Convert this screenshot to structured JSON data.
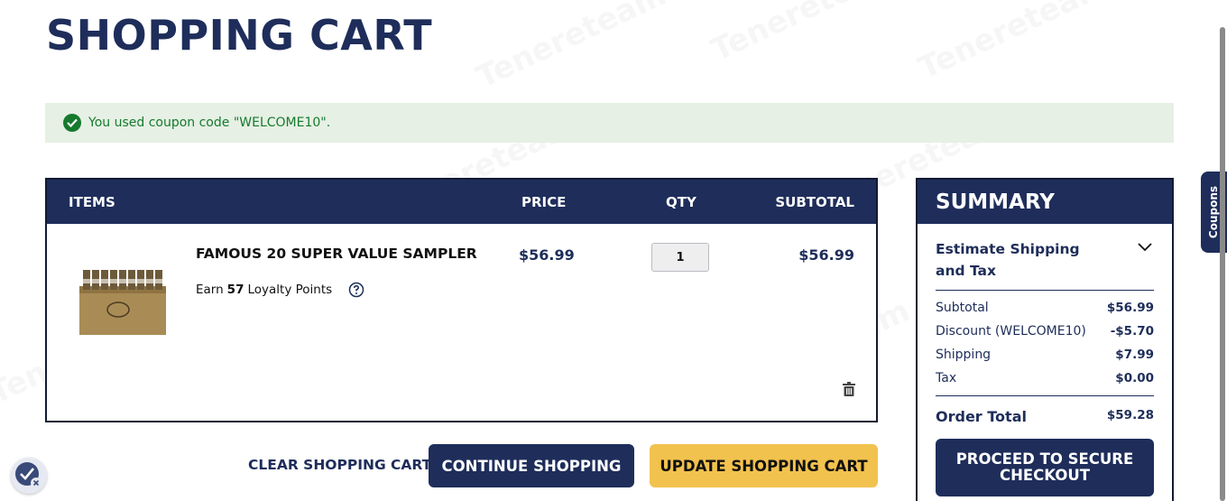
{
  "page": {
    "title": "SHOPPING CART"
  },
  "alert": {
    "message": "You used coupon code \"WELCOME10\"."
  },
  "cart": {
    "headers": {
      "items": "ITEMS",
      "price": "PRICE",
      "qty": "QTY",
      "subtotal": "SUBTOTAL"
    },
    "item": {
      "name": "FAMOUS 20 SUPER VALUE SAMPLER",
      "loyalty_prefix": "Earn",
      "loyalty_points": "57",
      "loyalty_suffix": "Loyalty Points",
      "price": "$56.99",
      "qty": "1",
      "subtotal": "$56.99"
    }
  },
  "actions": {
    "clear": "CLEAR SHOPPING CART",
    "continue": "CONTINUE SHOPPING",
    "update": "UPDATE SHOPPING CART"
  },
  "summary": {
    "title": "SUMMARY",
    "estimate": "Estimate Shipping and Tax",
    "rows": [
      {
        "label": "Subtotal",
        "value": "$56.99"
      },
      {
        "label": "Discount (WELCOME10)",
        "value": "-$5.70"
      },
      {
        "label": "Shipping",
        "value": "$7.99"
      },
      {
        "label": "Tax",
        "value": "$0.00"
      }
    ],
    "total_label": "Order Total",
    "total_value": "$59.28",
    "checkout": "PROCEED TO SECURE CHECKOUT"
  },
  "coupons_tab": "Coupons",
  "watermark": "Tenereteam",
  "colors": {
    "navy": "#1e2d5a",
    "yellow": "#f2c24e",
    "success": "#167a2e",
    "alert_bg": "#e6f0e4"
  },
  "icons": [
    "check-circle-icon",
    "help-circle-icon",
    "trash-icon",
    "chevron-down-icon",
    "verified-badge-icon"
  ]
}
